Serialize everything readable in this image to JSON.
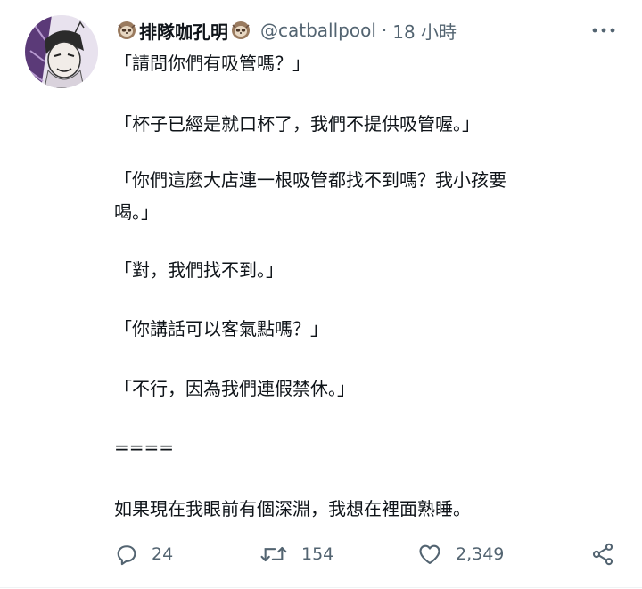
{
  "author": {
    "name": "排隊咖孔明",
    "handle": "@catballpool",
    "separator": "·",
    "time": "18 小時",
    "emoji_icon": "sloth-emoji"
  },
  "tweet": {
    "lines": [
      "「請問你們有吸管嗎？」",
      "「杯子已經是就口杯了，我們不提供吸管喔。」",
      "「你們這麼大店連一根吸管都找不到嗎？我小孩要",
      "喝。」",
      "「對，我們找不到。」",
      "「你講話可以客氣點嗎？」",
      "「不行，因為我們連假禁休。」",
      "====",
      "如果現在我眼前有個深淵，我想在裡面熟睡。"
    ]
  },
  "actions": {
    "reply_count": "24",
    "retweet_count": "154",
    "like_count": "2,349"
  },
  "colors": {
    "text": "#0f1419",
    "secondary": "#536471"
  }
}
